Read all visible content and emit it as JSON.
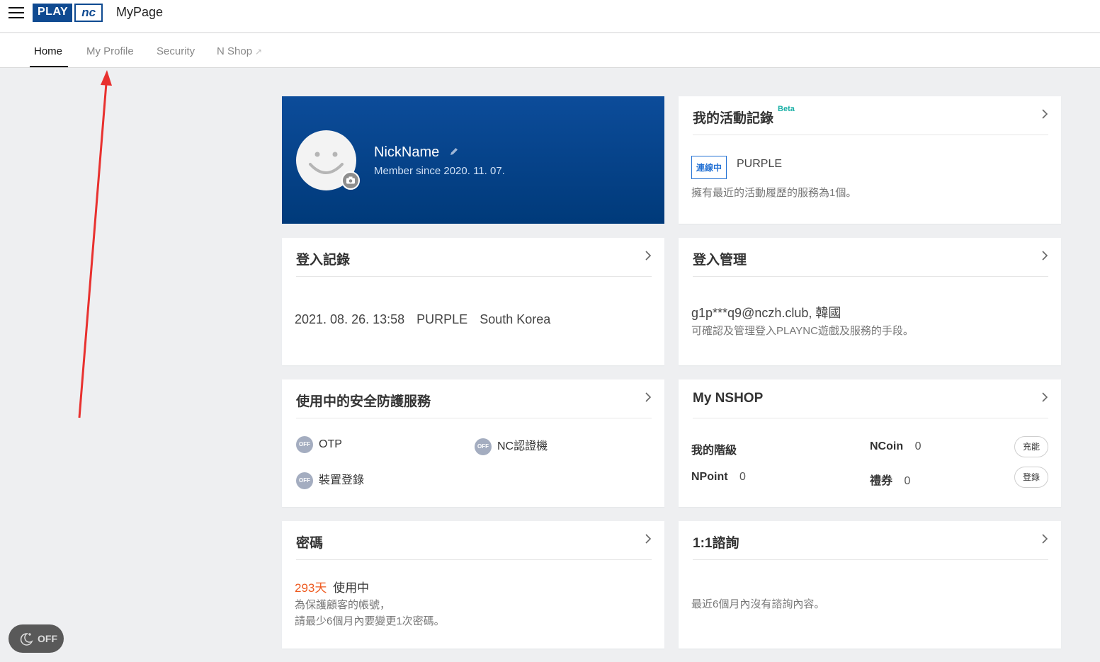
{
  "header": {
    "logo_play": "PLAY",
    "logo_nc": "nc",
    "title": "MyPage"
  },
  "tabs": [
    {
      "label": "Home",
      "active": true
    },
    {
      "label": "My Profile",
      "active": false
    },
    {
      "label": "Security",
      "active": false
    },
    {
      "label": "N Shop",
      "active": false,
      "external": true
    }
  ],
  "profile": {
    "nickname": "NickName",
    "member_since": "Member since 2020. 11. 07."
  },
  "activity": {
    "title": "我的活動記錄",
    "beta": "Beta",
    "badge": "連線中",
    "service": "PURPLE",
    "desc": "擁有最近的活動履歷的服務為1個。"
  },
  "login_record": {
    "title": "登入記錄",
    "datetime": "2021. 08. 26. 13:58",
    "service": "PURPLE",
    "country": "South Korea"
  },
  "login_manage": {
    "title": "登入管理",
    "account": "g1p***q9@nczh.club",
    "region": "韓國",
    "desc": "可確認及管理登入PLAYNC遊戲及服務的手段。"
  },
  "security_services": {
    "title": "使用中的安全防護服務",
    "off_label": "OFF",
    "items": [
      "OTP",
      "NC認證機",
      "裝置登錄"
    ]
  },
  "nshop": {
    "title": "My NSHOP",
    "grade_label": "我的階級",
    "ncoin_label": "NCoin",
    "ncoin_value": "0",
    "charge_button": "充能",
    "npoint_label": "NPoint",
    "npoint_value": "0",
    "voucher_label": "禮券",
    "voucher_value": "0",
    "register_button": "登錄"
  },
  "password": {
    "title": "密碼",
    "days": "293天",
    "in_use": "使用中",
    "desc_line1": "為保護顧客的帳號，",
    "desc_line2": "請最少6個月內要變更1次密碼。"
  },
  "inquiry": {
    "title": "1:1諮詢",
    "desc": "最近6個月內沒有諮詢內容。"
  },
  "night_mode": {
    "label": "OFF"
  },
  "colors": {
    "brand_blue": "#0f4a91",
    "accent_orange": "#ee5a1f",
    "badge_blue": "#2371d4",
    "arrow_red": "#e8312f"
  }
}
